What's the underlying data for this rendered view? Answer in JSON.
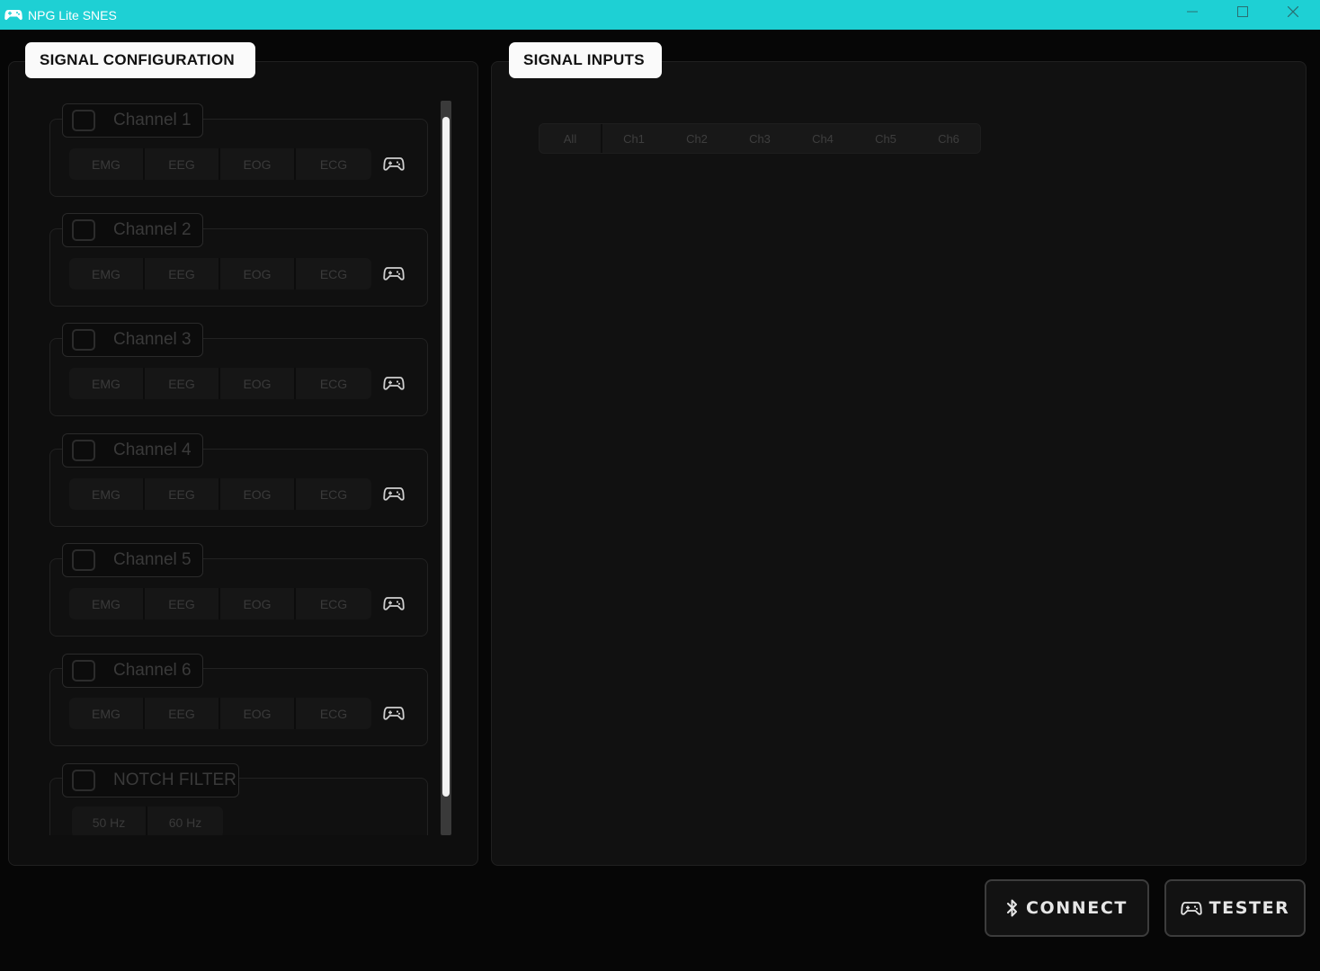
{
  "window": {
    "title": "NPG Lite SNES"
  },
  "panels": {
    "config_title": "SIGNAL CONFIGURATION",
    "inputs_title": "SIGNAL INPUTS"
  },
  "channels": [
    {
      "label": "Channel 1",
      "types": [
        "EMG",
        "EEG",
        "EOG",
        "ECG"
      ]
    },
    {
      "label": "Channel 2",
      "types": [
        "EMG",
        "EEG",
        "EOG",
        "ECG"
      ]
    },
    {
      "label": "Channel 3",
      "types": [
        "EMG",
        "EEG",
        "EOG",
        "ECG"
      ]
    },
    {
      "label": "Channel 4",
      "types": [
        "EMG",
        "EEG",
        "EOG",
        "ECG"
      ]
    },
    {
      "label": "Channel 5",
      "types": [
        "EMG",
        "EEG",
        "EOG",
        "ECG"
      ]
    },
    {
      "label": "Channel 6",
      "types": [
        "EMG",
        "EEG",
        "EOG",
        "ECG"
      ]
    }
  ],
  "notch": {
    "label": "NOTCH FILTER",
    "options": [
      "50 Hz",
      "60 Hz"
    ]
  },
  "channel_selector": [
    "All",
    "Ch1",
    "Ch2",
    "Ch3",
    "Ch4",
    "Ch5",
    "Ch6"
  ],
  "buttons": {
    "connect": "CONNECT",
    "tester": "TESTER"
  },
  "colors": {
    "titlebar": "#1ed0d4",
    "background": "#060606",
    "disabled_text": "#3a3a3a"
  },
  "icons": {
    "app": "gamepad-icon",
    "channel": "gamepad-icon",
    "connect": "bluetooth-icon",
    "tester": "gamepad-icon"
  }
}
